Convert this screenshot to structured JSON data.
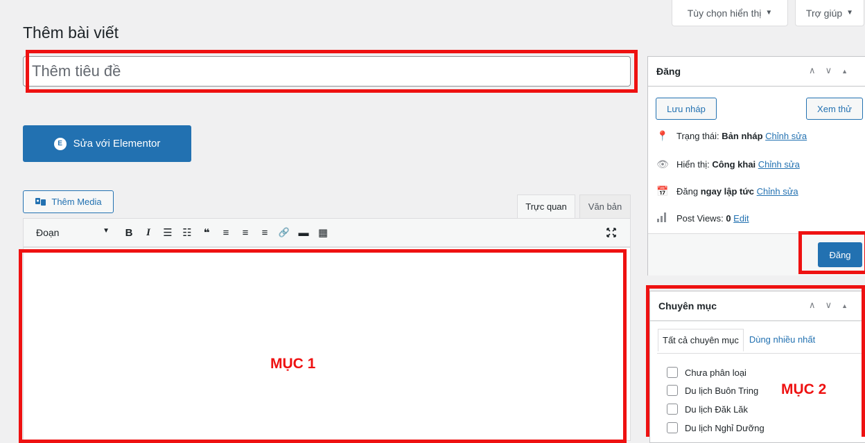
{
  "top": {
    "screen_options": "Tùy chọn hiển thị",
    "help": "Trợ giúp",
    "dropdown_glyph": "▼"
  },
  "page_title": "Thêm bài viết",
  "title_placeholder": "Thêm tiêu đề",
  "elementor_button": "Sửa với Elementor",
  "elementor_logo": "E",
  "add_media": "Thêm Media",
  "editor_tabs": {
    "visual": "Trực quan",
    "text": "Văn bản"
  },
  "toolbar": {
    "format_select": "Đoạn",
    "icons": [
      "bold-icon",
      "italic-icon",
      "bullet-list-icon",
      "numbered-list-icon",
      "quote-icon",
      "align-left-icon",
      "align-center-icon",
      "align-right-icon",
      "link-icon",
      "read-more-icon",
      "toolbar-toggle-icon"
    ],
    "glyphs": [
      "B",
      "I",
      "☰",
      "☷",
      "❝",
      "≡",
      "≡",
      "≡",
      "🔗",
      "▬",
      "▦"
    ]
  },
  "labels": {
    "muc1": "MỤC 1",
    "muc2": "MỤC 2"
  },
  "publish_box": {
    "title": "Đăng",
    "save_draft": "Lưu nháp",
    "preview": "Xem thử",
    "status_label": "Trạng thái:",
    "status_value": "Bản nháp",
    "visibility_label": "Hiển thị:",
    "visibility_value": "Công khai",
    "schedule_prefix": "Đăng",
    "schedule_value": "ngay lập tức",
    "views_label": "Post Views:",
    "views_value": "0",
    "edit_link": "Chỉnh sửa",
    "views_edit": "Edit",
    "publish": "Đăng"
  },
  "categories_box": {
    "title": "Chuyên mục",
    "tab_all": "Tất cả chuyên mục",
    "tab_popular": "Dùng nhiều nhất",
    "items": [
      "Chưa phân loại",
      "Du lịch Buôn Tring",
      "Du lịch Đăk Lăk",
      "Du lịch Nghỉ Dưỡng"
    ]
  },
  "colors": {
    "accent": "#2271b1",
    "highlight": "#ee1111"
  }
}
